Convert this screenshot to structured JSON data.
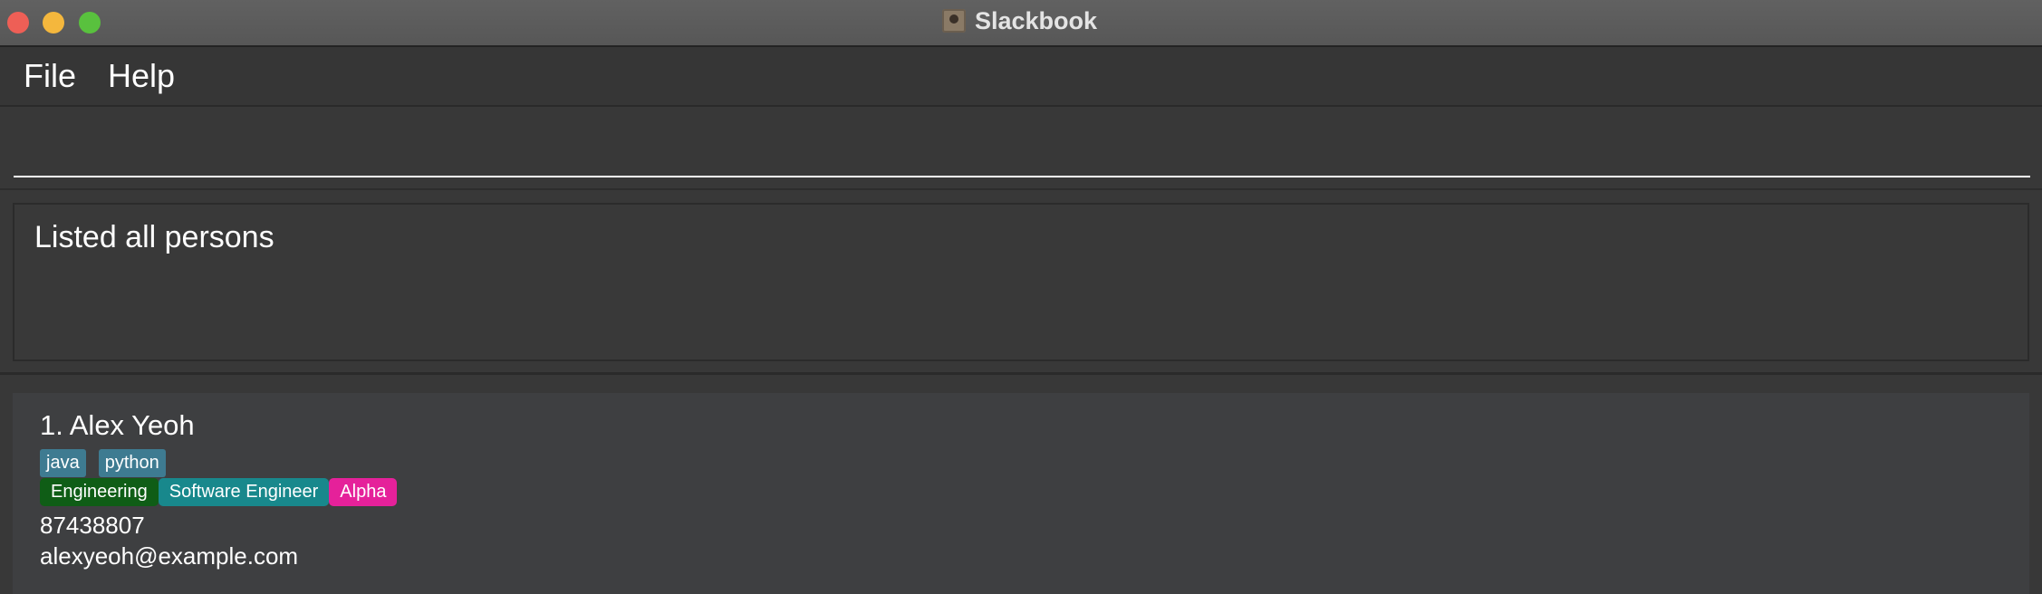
{
  "window": {
    "title": "Slackbook"
  },
  "menu": {
    "items": [
      {
        "label": "File"
      },
      {
        "label": "Help"
      }
    ]
  },
  "command": {
    "value": "",
    "placeholder": ""
  },
  "result": {
    "message": "Listed all persons"
  },
  "persons": [
    {
      "index_name": "1. Alex Yeoh",
      "skills": [
        "java",
        "python"
      ],
      "department": "Engineering",
      "role": "Software Engineer",
      "team": "Alpha",
      "phone": "87438807",
      "email": "alexyeoh@example.com"
    }
  ],
  "colors": {
    "skill_tag": "#3e7b91",
    "department_tag": "#0f5d16",
    "role_tag": "#18888c",
    "team_tag": "#e5219a",
    "background": "#383838"
  },
  "icons": {
    "app": "address-book-icon",
    "close": "close-window-icon",
    "minimize": "minimize-window-icon",
    "maximize": "maximize-window-icon"
  }
}
